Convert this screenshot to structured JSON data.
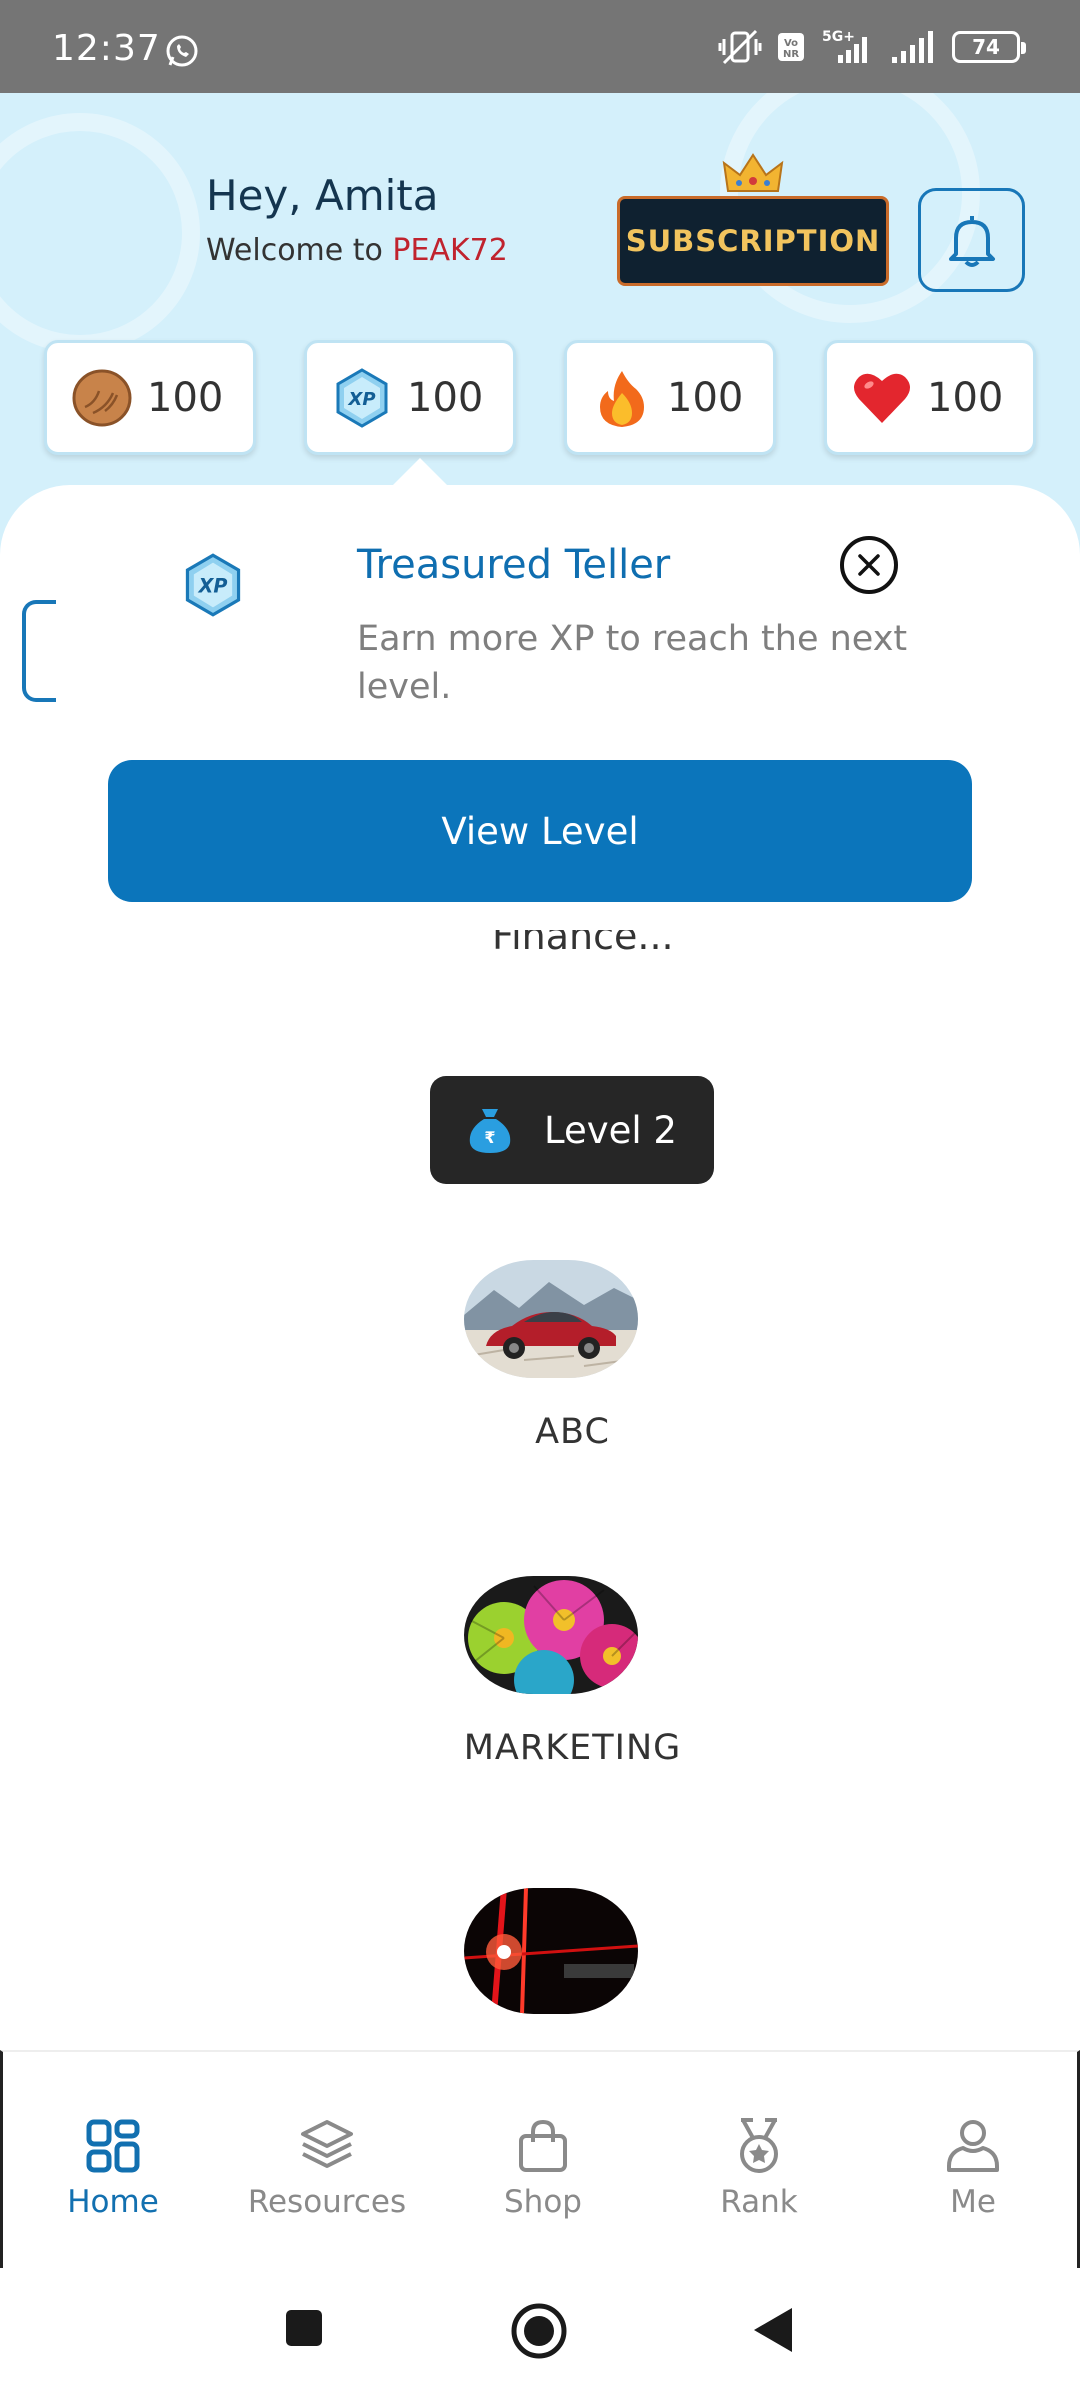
{
  "status_bar": {
    "time": "12:37",
    "battery": "74",
    "icons": [
      "whatsapp-icon",
      "vibrate-icon",
      "volte-icon",
      "5g-signal-icon",
      "signal-icon",
      "battery-icon"
    ]
  },
  "header": {
    "greeting": "Hey, Amita",
    "welcome_prefix": "Welcome to ",
    "brand": "PEAK72",
    "subscription_label": "SUBSCRIPTION",
    "brand_color": "#c0232e",
    "accent_color": "#0b75bb"
  },
  "stats": [
    {
      "icon": "walnut-icon",
      "value": "100"
    },
    {
      "icon": "xp-icon",
      "value": "100"
    },
    {
      "icon": "fire-icon",
      "value": "100"
    },
    {
      "icon": "heart-icon",
      "value": "100"
    }
  ],
  "popup": {
    "icon": "xp-icon",
    "title": "Treasured Teller",
    "description": "Earn more XP to reach the next level.",
    "button_label": "View Level"
  },
  "content": {
    "cut_text": "Finance...",
    "level_label": "Level 2",
    "courses": [
      {
        "label": "ABC",
        "image": "red-sports-car"
      },
      {
        "label": "MARKETING",
        "image": "colorful-daisies"
      },
      {
        "label": "",
        "image": "red-light-streaks"
      }
    ]
  },
  "bottom_nav": {
    "items": [
      {
        "label": "Home",
        "icon": "grid-icon",
        "active": true
      },
      {
        "label": "Resources",
        "icon": "layers-icon",
        "active": false
      },
      {
        "label": "Shop",
        "icon": "shopping-bag-icon",
        "active": false
      },
      {
        "label": "Rank",
        "icon": "medal-icon",
        "active": false
      },
      {
        "label": "Me",
        "icon": "person-icon",
        "active": false
      }
    ]
  }
}
